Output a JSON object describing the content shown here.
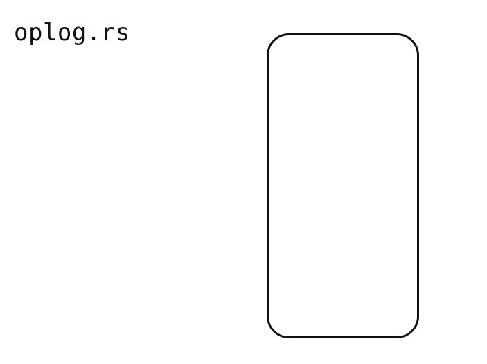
{
  "diagram": {
    "title": "oplog.rs",
    "colors": {
      "background": "#ffffff",
      "stroke": "#111111",
      "text": "#111111"
    }
  }
}
